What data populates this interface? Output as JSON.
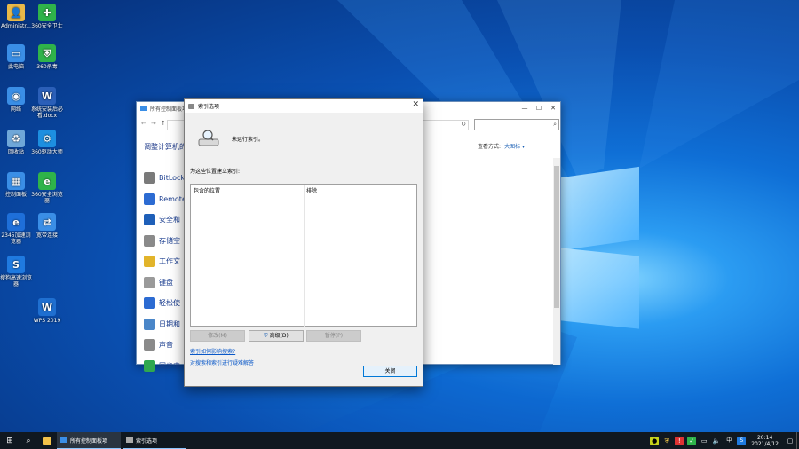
{
  "desktop": {
    "icons": [
      {
        "label": "Administr...",
        "color": "#e9b949",
        "glyph": "👤"
      },
      {
        "label": "360安全卫士",
        "color": "#2fb34a",
        "glyph": "✚"
      },
      {
        "label": "此电脑",
        "color": "#3a8ee6",
        "glyph": "▭"
      },
      {
        "label": "360杀毒",
        "color": "#2fb34a",
        "glyph": "⛨"
      },
      {
        "label": "网络",
        "color": "#3a8ee6",
        "glyph": "◉"
      },
      {
        "label": "系统安装后必看.docx",
        "color": "#2b5fb8",
        "glyph": "W"
      },
      {
        "label": "回收站",
        "color": "#6fa7d8",
        "glyph": "♻"
      },
      {
        "label": "360驱动大师",
        "color": "#1d8fe0",
        "glyph": "⚙"
      },
      {
        "label": "控制面板",
        "color": "#3a8ee6",
        "glyph": "▦"
      },
      {
        "label": "360安全浏览器",
        "color": "#2fb34a",
        "glyph": "e"
      },
      {
        "label": "2345加速浏览器",
        "color": "#1e6fd9",
        "glyph": "e"
      },
      {
        "label": "宽带连接",
        "color": "#3a8ee6",
        "glyph": "⇄"
      },
      {
        "label": "搜狗高速浏览器",
        "color": "#1f7ae0",
        "glyph": "S"
      },
      {
        "label": "WPS 2019",
        "color": "#1f6fd0",
        "glyph": "W"
      }
    ]
  },
  "control_panel": {
    "title": "所有控制面板项",
    "heading": "调整计算机的",
    "view_label": "查看方式:",
    "view_value": "大图标 ▾",
    "items": [
      {
        "label": "BitLock",
        "color": "#7a7a7a"
      },
      {
        "label": "Remote",
        "color": "#2c6bd2"
      },
      {
        "label": "安全和",
        "color": "#1e5fb8"
      },
      {
        "label": "存储空",
        "color": "#8a8a8a"
      },
      {
        "label": "工作文",
        "color": "#e2b42a"
      },
      {
        "label": "键盘",
        "color": "#9a9a9a"
      },
      {
        "label": "轻松使",
        "color": "#2c6bd2"
      },
      {
        "label": "日期和",
        "color": "#4a86c8"
      },
      {
        "label": "声音",
        "color": "#8a8a8a"
      },
      {
        "label": "同步中",
        "color": "#2fa84f"
      }
    ]
  },
  "dialog": {
    "title": "索引选项",
    "close_glyph": "✕",
    "status": "未运行索引。",
    "list_label": "为这些位置建立索引:",
    "columns": [
      "包含的位置",
      "排除"
    ],
    "buttons": {
      "modify": "修改(M)",
      "advanced": "高级(D)",
      "pause": "暂停(P)",
      "close": "关闭"
    },
    "links": [
      "索引如何影响搜索?",
      "对搜索和索引进行疑难解答"
    ]
  },
  "taskbar": {
    "tasks": [
      "所有控制面板项",
      "索引选项"
    ],
    "time": "20:14",
    "date": "2021/4/12",
    "ime": "中"
  }
}
